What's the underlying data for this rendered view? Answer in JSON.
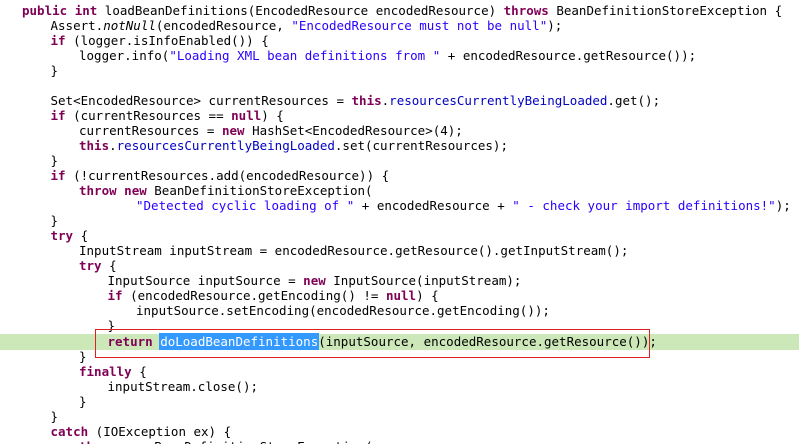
{
  "editor": {
    "colors": {
      "keyword": "#7f0055",
      "string": "#2a00ff",
      "field": "#0000c0",
      "current_line": "#cde8b8",
      "selection": "#3399ff",
      "focus_box": "#e02020"
    },
    "lines": [
      {
        "indent": 0,
        "tokens": [
          [
            "kw",
            "public"
          ],
          [
            "t",
            " "
          ],
          [
            "kw",
            "int"
          ],
          [
            "t",
            " loadBeanDefinitions(EncodedResource encodedResource) "
          ],
          [
            "kw",
            "throws"
          ],
          [
            "t",
            " BeanDefinitionStoreException {"
          ]
        ]
      },
      {
        "indent": 1,
        "tokens": [
          [
            "t",
            "Assert."
          ],
          [
            "i",
            "notNull"
          ],
          [
            "t",
            "(encodedResource, "
          ],
          [
            "s",
            "\"EncodedResource must not be null\""
          ],
          [
            "t",
            ");"
          ]
        ]
      },
      {
        "indent": 1,
        "tokens": [
          [
            "kw",
            "if"
          ],
          [
            "t",
            " (logger.isInfoEnabled()) {"
          ]
        ]
      },
      {
        "indent": 2,
        "tokens": [
          [
            "t",
            "logger.info("
          ],
          [
            "s",
            "\"Loading XML bean definitions from \""
          ],
          [
            "t",
            " + encodedResource.getResource());"
          ]
        ]
      },
      {
        "indent": 1,
        "tokens": [
          [
            "t",
            "}"
          ]
        ]
      },
      {
        "indent": 0,
        "tokens": []
      },
      {
        "indent": 1,
        "tokens": [
          [
            "t",
            "Set<EncodedResource> currentResources = "
          ],
          [
            "kw",
            "this"
          ],
          [
            "t",
            "."
          ],
          [
            "f",
            "resourcesCurrentlyBeingLoaded"
          ],
          [
            "t",
            ".get();"
          ]
        ]
      },
      {
        "indent": 1,
        "tokens": [
          [
            "kw",
            "if"
          ],
          [
            "t",
            " (currentResources == "
          ],
          [
            "kw",
            "null"
          ],
          [
            "t",
            ") {"
          ]
        ]
      },
      {
        "indent": 2,
        "tokens": [
          [
            "t",
            "currentResources = "
          ],
          [
            "kw",
            "new"
          ],
          [
            "t",
            " HashSet<EncodedResource>(4);"
          ]
        ]
      },
      {
        "indent": 2,
        "tokens": [
          [
            "kw",
            "this"
          ],
          [
            "t",
            "."
          ],
          [
            "f",
            "resourcesCurrentlyBeingLoaded"
          ],
          [
            "t",
            ".set(currentResources);"
          ]
        ]
      },
      {
        "indent": 1,
        "tokens": [
          [
            "t",
            "}"
          ]
        ]
      },
      {
        "indent": 1,
        "tokens": [
          [
            "kw",
            "if"
          ],
          [
            "t",
            " (!currentResources.add(encodedResource)) {"
          ]
        ]
      },
      {
        "indent": 2,
        "tokens": [
          [
            "kw",
            "throw"
          ],
          [
            "t",
            " "
          ],
          [
            "kw",
            "new"
          ],
          [
            "t",
            " BeanDefinitionStoreException("
          ]
        ]
      },
      {
        "indent": 4,
        "tokens": [
          [
            "s",
            "\"Detected cyclic loading of \""
          ],
          [
            "t",
            " + encodedResource + "
          ],
          [
            "s",
            "\" - check your import definitions!\""
          ],
          [
            "t",
            ");"
          ]
        ]
      },
      {
        "indent": 1,
        "tokens": [
          [
            "t",
            "}"
          ]
        ]
      },
      {
        "indent": 1,
        "tokens": [
          [
            "kw",
            "try"
          ],
          [
            "t",
            " {"
          ]
        ]
      },
      {
        "indent": 2,
        "tokens": [
          [
            "t",
            "InputStream inputStream = encodedResource.getResource().getInputStream();"
          ]
        ]
      },
      {
        "indent": 2,
        "tokens": [
          [
            "kw",
            "try"
          ],
          [
            "t",
            " {"
          ]
        ]
      },
      {
        "indent": 3,
        "tokens": [
          [
            "t",
            "InputSource inputSource = "
          ],
          [
            "kw",
            "new"
          ],
          [
            "t",
            " InputSource(inputStream);"
          ]
        ]
      },
      {
        "indent": 3,
        "tokens": [
          [
            "kw",
            "if"
          ],
          [
            "t",
            " (encodedResource.getEncoding() != "
          ],
          [
            "kw",
            "null"
          ],
          [
            "t",
            ") {"
          ]
        ]
      },
      {
        "indent": 4,
        "tokens": [
          [
            "t",
            "inputSource.setEncoding(encodedResource.getEncoding());"
          ]
        ]
      },
      {
        "indent": 3,
        "tokens": [
          [
            "t",
            "}"
          ]
        ]
      },
      {
        "indent": 3,
        "current": true,
        "tokens": [
          [
            "kw",
            "return"
          ],
          [
            "t",
            " "
          ],
          [
            "sel",
            "doLoadBeanDefinitions"
          ],
          [
            "t",
            "(inputSource, encodedResource.getResource());"
          ]
        ]
      },
      {
        "indent": 2,
        "tokens": [
          [
            "t",
            "}"
          ]
        ]
      },
      {
        "indent": 2,
        "tokens": [
          [
            "kw",
            "finally"
          ],
          [
            "t",
            " {"
          ]
        ]
      },
      {
        "indent": 3,
        "tokens": [
          [
            "t",
            "inputStream.close();"
          ]
        ]
      },
      {
        "indent": 2,
        "tokens": [
          [
            "t",
            "}"
          ]
        ]
      },
      {
        "indent": 1,
        "tokens": [
          [
            "t",
            "}"
          ]
        ]
      },
      {
        "indent": 1,
        "tokens": [
          [
            "kw",
            "catch"
          ],
          [
            "t",
            " (IOException ex) {"
          ]
        ]
      },
      {
        "indent": 2,
        "tokens": [
          [
            "kw",
            "throw"
          ],
          [
            "t",
            " "
          ],
          [
            "kw",
            "new"
          ],
          [
            "t",
            " BeanDefinitionStoreException("
          ]
        ]
      }
    ]
  }
}
